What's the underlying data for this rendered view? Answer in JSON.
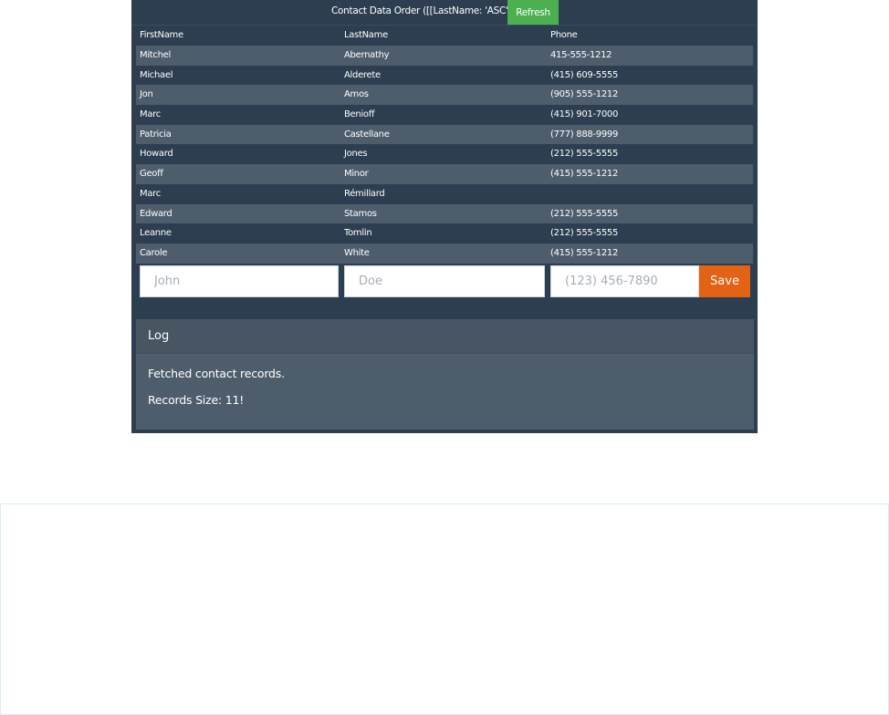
{
  "header": {
    "title": "Contact Data Order ([[LastName: 'ASC']])",
    "refresh_label": "Refresh"
  },
  "table": {
    "columns": [
      "FirstName",
      "LastName",
      "Phone"
    ],
    "rows": [
      [
        "Mitchel",
        "Abernathy",
        "415-555-1212"
      ],
      [
        "Michael",
        "Alderete",
        "(415) 609-5555"
      ],
      [
        "Jon",
        "Amos",
        "(905) 555-1212"
      ],
      [
        "Marc",
        "Benioff",
        "(415) 901-7000"
      ],
      [
        "Patricia",
        "Castellane",
        "(777) 888-9999"
      ],
      [
        "Howard",
        "Jones",
        "(212) 555-5555"
      ],
      [
        "Geoff",
        "Minor",
        "(415) 555-1212"
      ],
      [
        "Marc",
        "Rémillard",
        ""
      ],
      [
        "Edward",
        "Stamos",
        "(212) 555-5555"
      ],
      [
        "Leanne",
        "Tomlin",
        "(212) 555-5555"
      ],
      [
        "Carole",
        "White",
        "(415) 555-1212"
      ]
    ]
  },
  "form": {
    "first_placeholder": "John",
    "last_placeholder": "Doe",
    "phone_placeholder": "(123) 456-7890",
    "save_label": "Save"
  },
  "log": {
    "title": "Log",
    "lines": [
      "Fetched contact records.",
      "Records Size: 11!"
    ]
  },
  "colors": {
    "panel_bg": "#2c3e50",
    "row_alt": "#4e5d6c",
    "refresh_button": "#4caf50",
    "save_button": "#e16313"
  }
}
